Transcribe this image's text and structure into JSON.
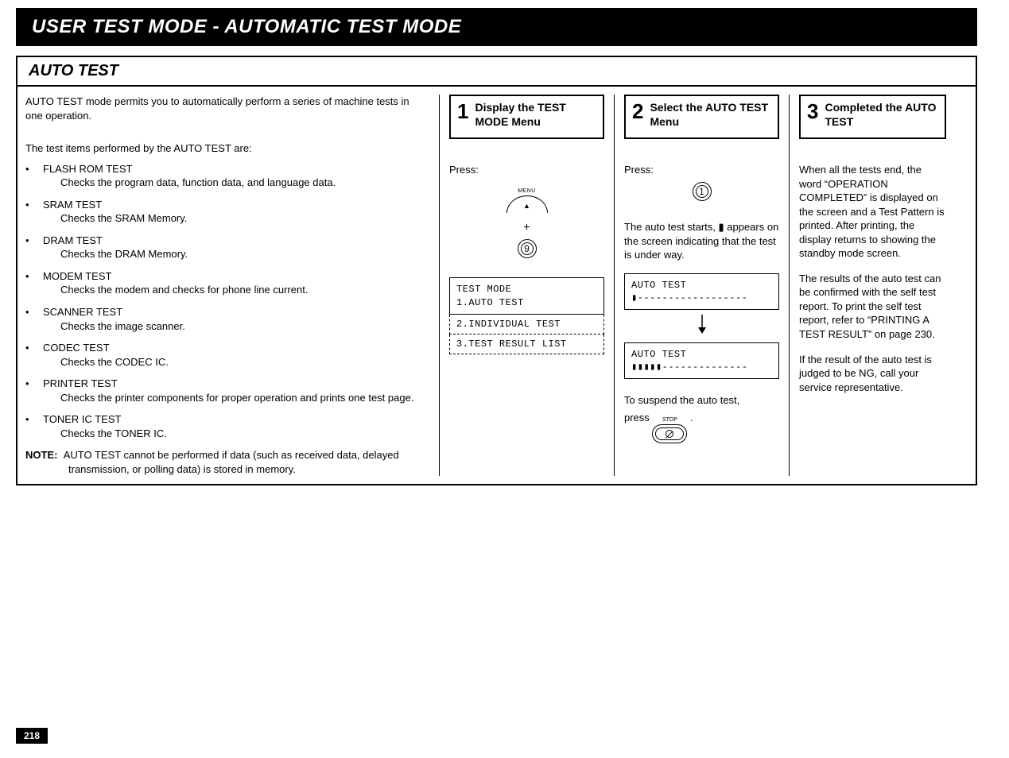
{
  "page_title": "USER TEST MODE - AUTOMATIC TEST MODE",
  "section_header": "AUTO TEST",
  "page_number": "218",
  "intro": "AUTO TEST mode permits you to automatically perform a series of machine tests in one operation.",
  "list_intro": "The test items performed by the AUTO TEST are:",
  "tests": [
    {
      "name": "FLASH ROM TEST",
      "desc": "Checks the program data, function data, and language data."
    },
    {
      "name": "SRAM TEST",
      "desc": "Checks the SRAM Memory."
    },
    {
      "name": "DRAM TEST",
      "desc": "Checks the DRAM Memory."
    },
    {
      "name": "MODEM TEST",
      "desc": "Checks the modem and checks for phone line current."
    },
    {
      "name": "SCANNER TEST",
      "desc": "Checks the image scanner."
    },
    {
      "name": "CODEC TEST",
      "desc": "Checks the CODEC IC."
    },
    {
      "name": "PRINTER TEST",
      "desc": "Checks the printer components for proper operation and prints one test page."
    },
    {
      "name": "TONER IC TEST",
      "desc": "Checks the TONER IC."
    }
  ],
  "note_label": "NOTE:",
  "note_text": "AUTO TEST cannot be performed if data (such as received data, delayed transmission, or polling data) is stored in memory.",
  "steps": {
    "s1": {
      "num": "1",
      "title": "Display the TEST MODE Menu",
      "press": "Press:",
      "menu_label": "MENU",
      "plus": "+",
      "key_digit": "9",
      "lcd_line1": "TEST MODE",
      "lcd_line2": "1.AUTO TEST",
      "lcd_opt2": "2.INDIVIDUAL TEST",
      "lcd_opt3": "3.TEST RESULT LIST"
    },
    "s2": {
      "num": "2",
      "title": "Select the AUTO TEST Menu",
      "press": "Press:",
      "key_digit": "1",
      "para1": "The auto test starts, ▮ appears on the screen indicating that the test is under way.",
      "lcd_a_line1": "AUTO TEST",
      "lcd_a_line2": "▮------------------",
      "lcd_b_line1": "AUTO TEST",
      "lcd_b_line2": "▮▮▮▮▮--------------",
      "suspend": "To suspend the auto test,",
      "press2_pre": "press",
      "press2_post": ".",
      "stop_label": "STOP"
    },
    "s3": {
      "num": "3",
      "title": "Completed the AUTO TEST",
      "p1": "When all the tests end, the word “OPERATION COMPLETED” is displayed on the screen and a Test Pattern is printed. After printing, the display returns to showing the standby mode screen.",
      "p2": "The results of the auto test can be confirmed with the self test report. To print the self test report, refer to “PRINTING A TEST RESULT” on page 230.",
      "p3": "If the result of the auto test is judged to be NG, call your service representative."
    }
  }
}
